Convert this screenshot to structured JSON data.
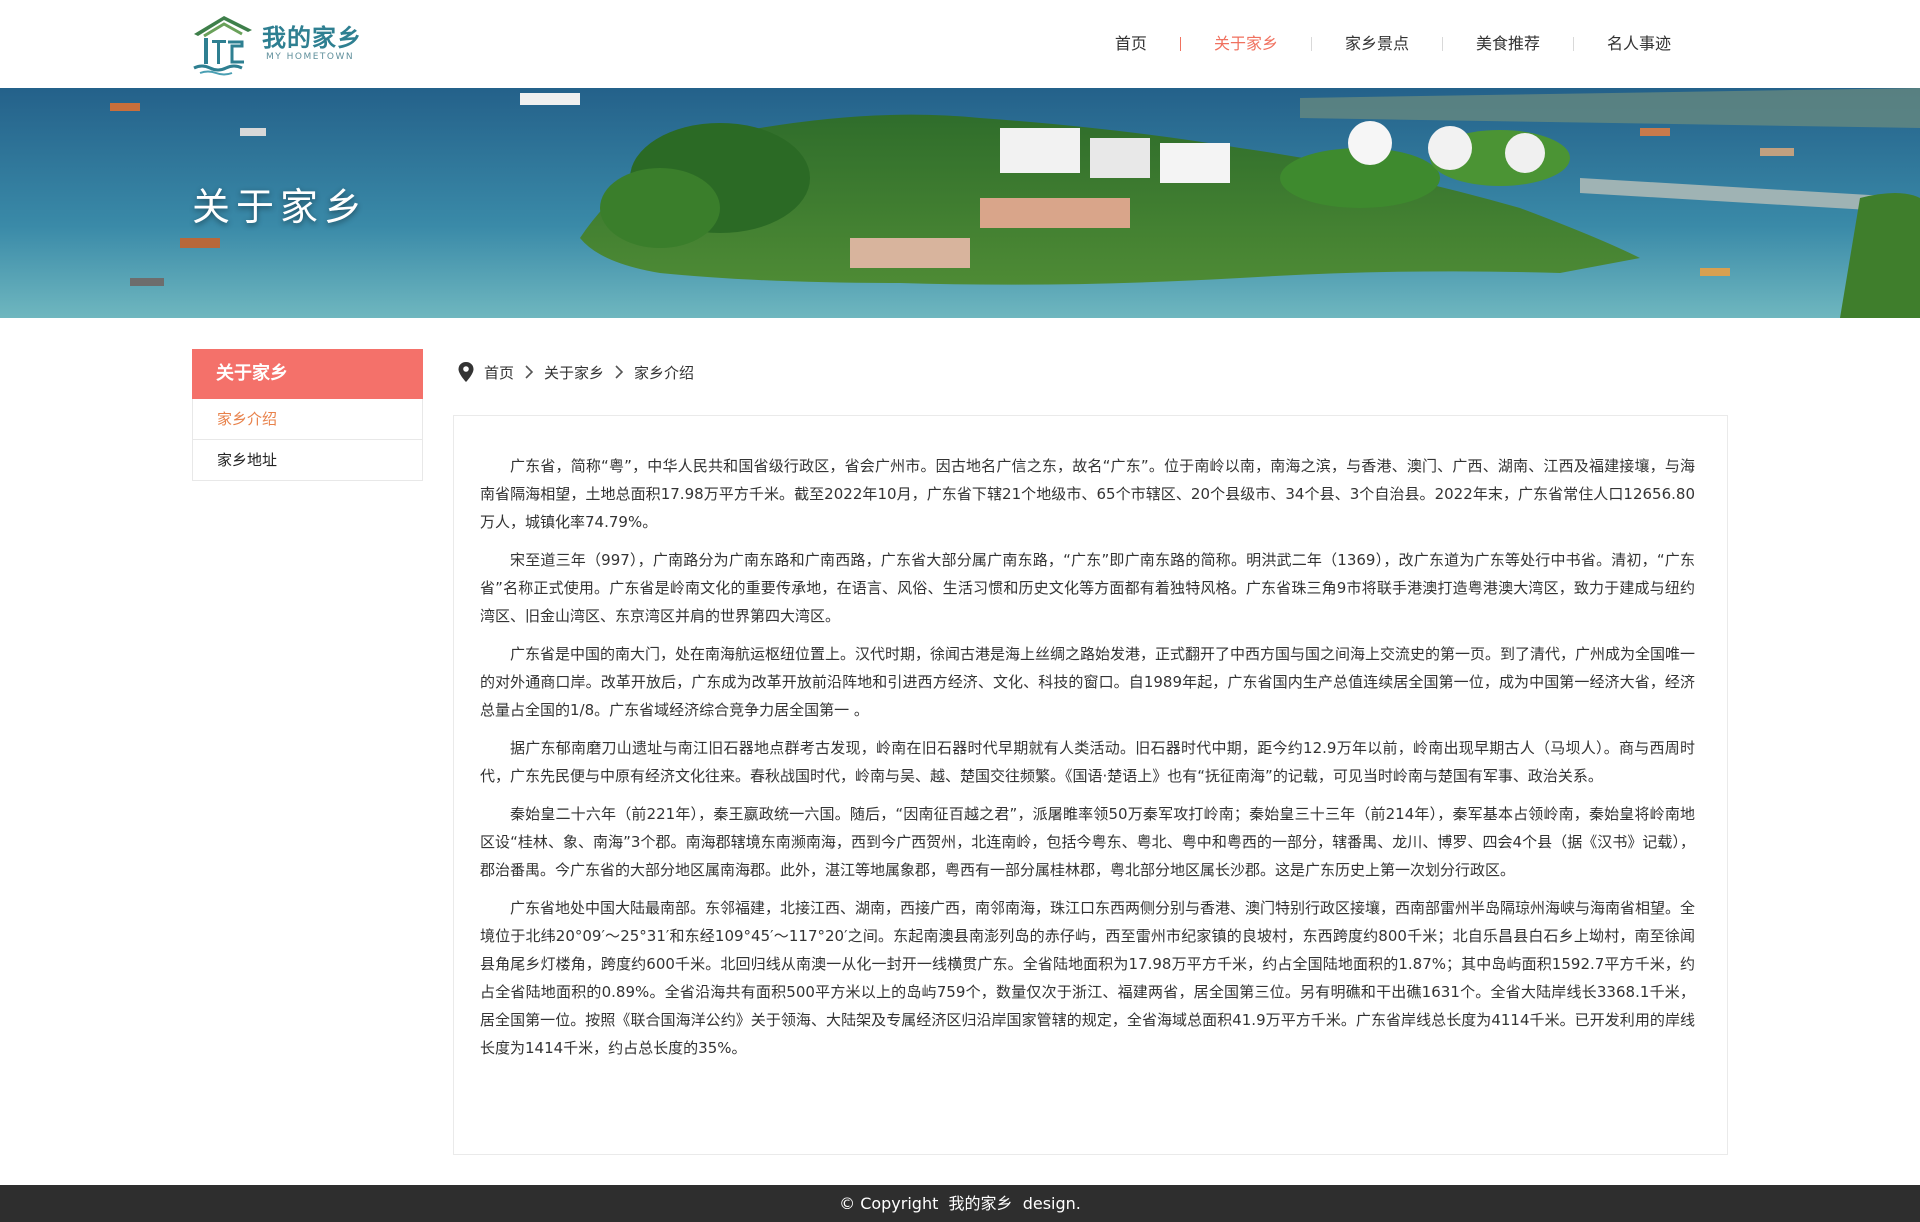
{
  "header": {
    "logo_text": "我的家乡",
    "logo_subtext": "MY HOMETOWN",
    "nav": [
      {
        "label": "首页"
      },
      {
        "label": "关于家乡"
      },
      {
        "label": "家乡景点"
      },
      {
        "label": "美食推荐"
      },
      {
        "label": "名人事迹"
      }
    ],
    "active_nav": "关于家乡",
    "accent_color": "#f0715f"
  },
  "banner": {
    "title": "关于家乡"
  },
  "sidebar": {
    "title": "关于家乡",
    "items": [
      {
        "label": "家乡介绍"
      },
      {
        "label": "家乡地址"
      }
    ],
    "active_item": "家乡介绍",
    "header_color": "#f4716a"
  },
  "breadcrumb": {
    "icon": "location-pin-icon",
    "items": [
      "首页",
      "关于家乡",
      "家乡介绍"
    ]
  },
  "article": {
    "paragraphs": [
      "广东省，简称“粤”，中华人民共和国省级行政区，省会广州市。因古地名广信之东，故名“广东”。位于南岭以南，南海之滨，与香港、澳门、广西、湖南、江西及福建接壤，与海南省隔海相望，土地总面积17.98万平方千米。截至2022年10月，广东省下辖21个地级市、65个市辖区、20个县级市、34个县、3个自治县。2022年末，广东省常住人口12656.80万人，城镇化率74.79%。",
      "宋至道三年（997），广南路分为广南东路和广南西路，广东省大部分属广南东路，“广东”即广南东路的简称。明洪武二年（1369），改广东道为广东等处行中书省。清初，“广东省”名称正式使用。广东省是岭南文化的重要传承地，在语言、风俗、生活习惯和历史文化等方面都有着独特风格。广东省珠三角9市将联手港澳打造粤港澳大湾区，致力于建成与纽约湾区、旧金山湾区、东京湾区并肩的世界第四大湾区。",
      "广东省是中国的南大门，处在南海航运枢纽位置上。汉代时期，徐闻古港是海上丝绸之路始发港，正式翻开了中西方国与国之间海上交流史的第一页。到了清代，广州成为全国唯一的对外通商口岸。改革开放后，广东成为改革开放前沿阵地和引进西方经济、文化、科技的窗口。自1989年起，广东省国内生产总值连续居全国第一位，成为中国第一经济大省，经济总量占全国的1/8。广东省域经济综合竞争力居全国第一 。",
      "据广东郁南磨刀山遗址与南江旧石器地点群考古发现，岭南在旧石器时代早期就有人类活动。旧石器时代中期，距今约12.9万年以前，岭南出现早期古人（马坝人）。商与西周时代，广东先民便与中原有经济文化往来。春秋战国时代，岭南与吴、越、楚国交往频繁。《国语·楚语上》也有“抚征南海”的记载，可见当时岭南与楚国有军事、政治关系。",
      "秦始皇二十六年（前221年），秦王嬴政统一六国。随后，“因南征百越之君”，派屠睢率领50万秦军攻打岭南；秦始皇三十三年（前214年），秦军基本占领岭南，秦始皇将岭南地区设“桂林、象、南海”3个郡。南海郡辖境东南濒南海，西到今广西贺州，北连南岭，包括今粤东、粤北、粤中和粤西的一部分，辖番禺、龙川、博罗、四会4个县（据《汉书》记载），郡治番禺。今广东省的大部分地区属南海郡。此外，湛江等地属象郡，粤西有一部分属桂林郡，粤北部分地区属长沙郡。这是广东历史上第一次划分行政区。",
      "广东省地处中国大陆最南部。东邻福建，北接江西、湖南，西接广西，南邻南海，珠江口东西两侧分别与香港、澳门特别行政区接壤，西南部雷州半岛隔琼州海峡与海南省相望。全境位于北纬20°09′～25°31′和东经109°45′～117°20′之间。东起南澳县南澎列岛的赤仔屿，西至雷州市纪家镇的良坡村，东西跨度约800千米；北自乐昌县白石乡上坳村，南至徐闻县角尾乡灯楼角，跨度约600千米。北回归线从南澳一从化一封开一线横贯广东。全省陆地面积为17.98万平方千米，约占全国陆地面积的1.87%；其中岛屿面积1592.7平方千米，约占全省陆地面积的0.89%。全省沿海共有面积500平方米以上的岛屿759个，数量仅次于浙江、福建两省，居全国第三位。另有明礁和干出礁1631个。全省大陆岸线长3368.1千米，居全国第一位。按照《联合国海洋公约》关于领海、大陆架及专属经济区归沿岸国家管辖的规定，全省海域总面积41.9万平方千米。广东省岸线总长度为4114千米。已开发利用的岸线长度为1414千米，约占总长度的35%。"
    ]
  },
  "footer": {
    "copyright_symbol": "©",
    "text": "Copyright  我的家乡  design."
  }
}
